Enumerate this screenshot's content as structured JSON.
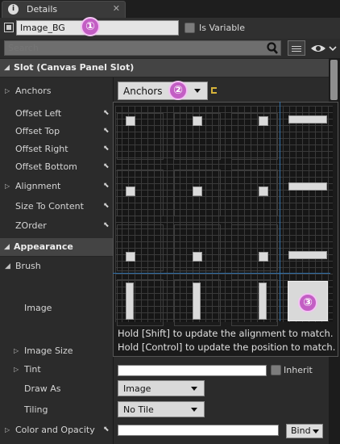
{
  "tab": {
    "label": "Details",
    "icon": "info-icon",
    "close": "✕"
  },
  "name_row": {
    "widget_name": "Image_BG",
    "is_variable_label": "Is Variable"
  },
  "search": {
    "placeholder": "Search"
  },
  "slot_section": {
    "title": "Slot (Canvas Panel Slot)",
    "properties": [
      {
        "label": "Anchors"
      },
      {
        "label": "Offset Left"
      },
      {
        "label": "Offset Top"
      },
      {
        "label": "Offset Right"
      },
      {
        "label": "Offset Bottom"
      },
      {
        "label": "Alignment"
      },
      {
        "label": "Size To Content"
      },
      {
        "label": "ZOrder"
      }
    ],
    "anchors_value": "Anchors"
  },
  "appearance_section": {
    "title": "Appearance",
    "brush_label": "Brush",
    "image_label": "Image",
    "image_size_label": "Image Size",
    "tint_label": "Tint",
    "inherit_label": "Inherit",
    "draw_as_label": "Draw As",
    "draw_as_value": "Image",
    "tiling_label": "Tiling",
    "tiling_value": "No Tile",
    "color_opacity_label": "Color and Opacity",
    "bind_label": "Bind"
  },
  "anchor_popup": {
    "hint_line1": "Hold [Shift] to update the alignment to match.",
    "hint_line2": "Hold [Control] to update the position to match.",
    "selected_preset": "stretch-both"
  },
  "callouts": [
    "①",
    "②",
    "③"
  ],
  "colors": {
    "callout": "#c35ec4",
    "guide_line": "#2f6fa8",
    "reset_arrow": "#d6b33a"
  }
}
